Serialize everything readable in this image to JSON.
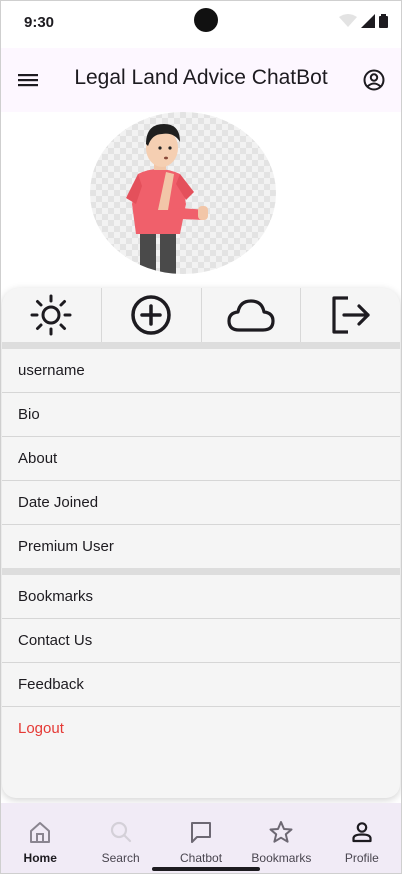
{
  "status_bar": {
    "time": "9:30"
  },
  "app_bar": {
    "title": "Legal Land Advice ChatBot"
  },
  "actions": [
    {
      "icon": "sun-icon"
    },
    {
      "icon": "plus-circle-icon"
    },
    {
      "icon": "cloud-icon"
    },
    {
      "icon": "logout-icon"
    }
  ],
  "profile_info": [
    "username",
    "Bio",
    "About",
    "Date Joined",
    "Premium User"
  ],
  "menu": {
    "bookmarks": "Bookmarks",
    "contact": "Contact Us",
    "feedback": "Feedback",
    "logout": "Logout"
  },
  "nav": {
    "home": "Home",
    "search": "Search",
    "chatbot": "Chatbot",
    "bookmarks": "Bookmarks",
    "profile": "Profile"
  },
  "colors": {
    "logout": "#e53935",
    "app_bar_bg": "#fdf7ff",
    "nav_bg": "#f1ebf6"
  }
}
